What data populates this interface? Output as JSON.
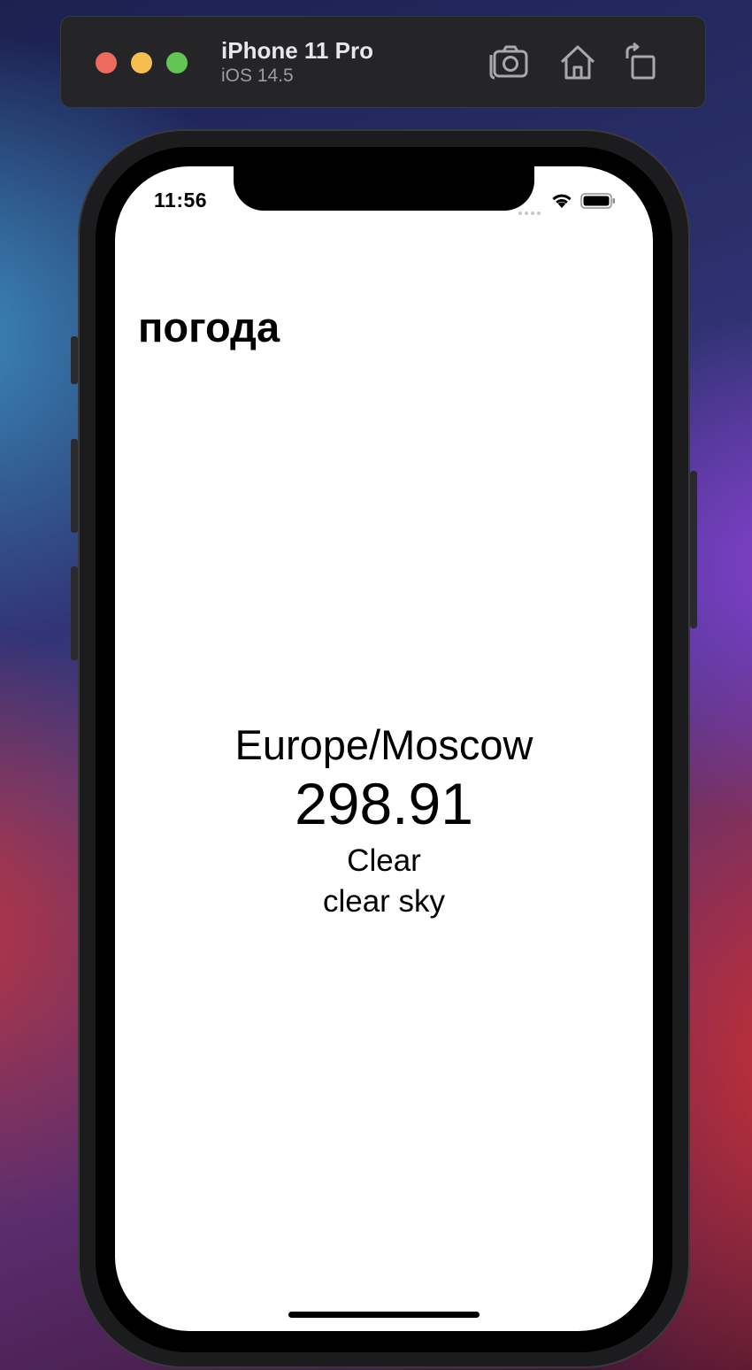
{
  "simulator": {
    "device_name": "iPhone 11 Pro",
    "os_version": "iOS 14.5",
    "toolbar": [
      "screenshot-icon",
      "home-icon",
      "rotate-icon"
    ]
  },
  "status_bar": {
    "time": "11:56",
    "icons": [
      "signal-icon",
      "wifi-icon",
      "battery-icon"
    ]
  },
  "app": {
    "title": "погода",
    "weather": {
      "city": "Europe/Moscow",
      "temperature": "298.91",
      "main": "Clear",
      "description": "clear sky"
    }
  },
  "colors": {
    "window_controls": [
      "#ee6a5f",
      "#f5be4f",
      "#62c554"
    ],
    "screen_background": "#ffffff"
  }
}
